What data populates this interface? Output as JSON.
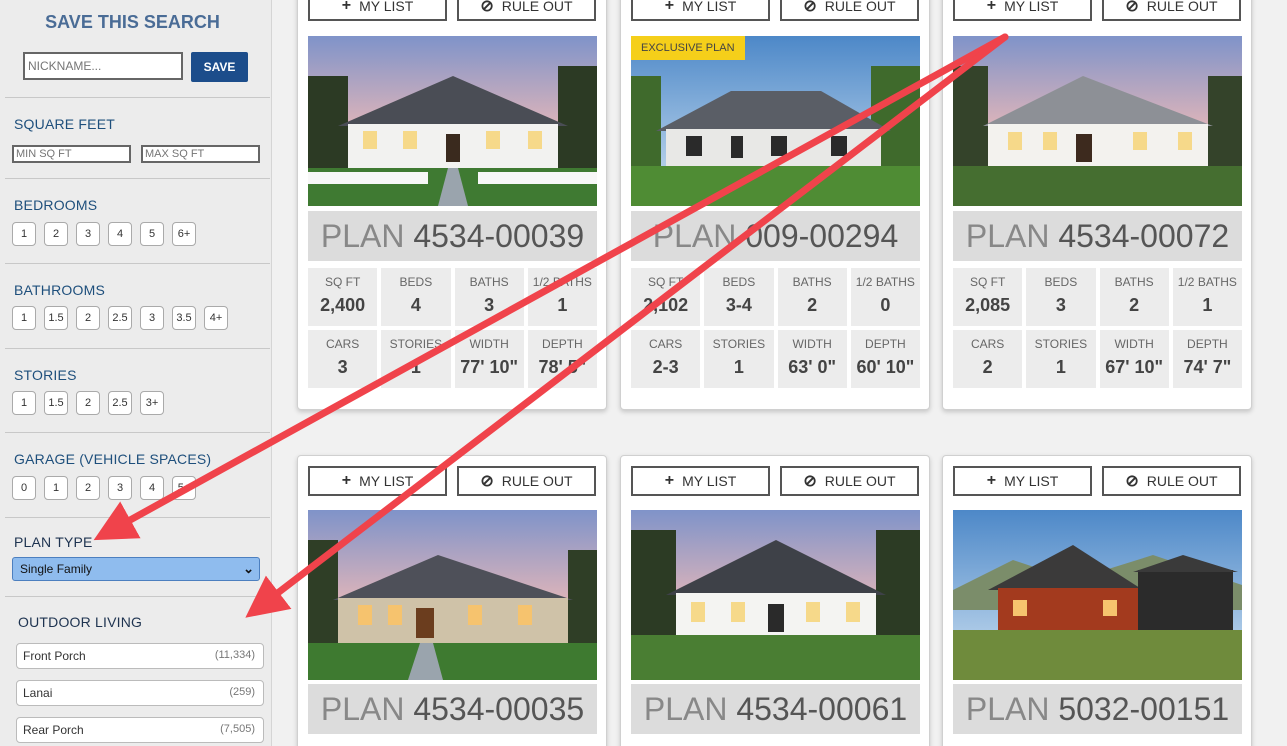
{
  "sidebar": {
    "save_title": "SAVE THIS SEARCH",
    "nickname_placeholder": "NICKNAME...",
    "save_label": "SAVE",
    "square_feet": {
      "title": "SQUARE FEET",
      "min_placeholder": "MIN SQ FT",
      "max_placeholder": "MAX SQ FT"
    },
    "bedrooms": {
      "title": "BEDROOMS",
      "options": [
        "1",
        "2",
        "3",
        "4",
        "5",
        "6+"
      ]
    },
    "bathrooms": {
      "title": "BATHROOMS",
      "options": [
        "1",
        "1.5",
        "2",
        "2.5",
        "3",
        "3.5",
        "4+"
      ]
    },
    "stories": {
      "title": "STORIES",
      "options": [
        "1",
        "1.5",
        "2",
        "2.5",
        "3+"
      ]
    },
    "garage": {
      "title": "GARAGE (VEHICLE SPACES)",
      "options": [
        "0",
        "1",
        "2",
        "3",
        "4",
        "5+"
      ]
    },
    "plan_type": {
      "title": "PLAN TYPE",
      "selected": "Single Family"
    },
    "outdoor_living": {
      "title": "OUTDOOR LIVING",
      "items": [
        {
          "label": "Front Porch",
          "count": "(11,334)"
        },
        {
          "label": "Lanai",
          "count": "(259)"
        },
        {
          "label": "Rear Porch",
          "count": "(7,505)"
        }
      ]
    }
  },
  "buttons": {
    "my_list": "MY LIST",
    "rule_out": "RULE OUT"
  },
  "labels": {
    "plan_prefix": "PLAN",
    "sqft": "SQ FT",
    "beds": "BEDS",
    "baths": "BATHS",
    "half_baths": "1/2 BATHS",
    "cars": "CARS",
    "stories": "STORIES",
    "width": "WIDTH",
    "depth": "DEPTH"
  },
  "cards": [
    {
      "plan": "4534-00039",
      "badge": "",
      "sqft": "2,400",
      "beds": "4",
      "baths": "3",
      "half_baths": "1",
      "cars": "3",
      "stories": "1",
      "width": "77' 10\"",
      "depth": "78' 5\""
    },
    {
      "plan": "009-00294",
      "badge": "EXCLUSIVE PLAN",
      "sqft": "2,102",
      "beds": "3-4",
      "baths": "2",
      "half_baths": "0",
      "cars": "2-3",
      "stories": "1",
      "width": "63' 0\"",
      "depth": "60' 10\""
    },
    {
      "plan": "4534-00072",
      "badge": "",
      "sqft": "2,085",
      "beds": "3",
      "baths": "2",
      "half_baths": "1",
      "cars": "2",
      "stories": "1",
      "width": "67' 10\"",
      "depth": "74' 7\""
    },
    {
      "plan": "4534-00035"
    },
    {
      "plan": "4534-00061"
    },
    {
      "plan": "5032-00151"
    }
  ],
  "colors": {
    "accent": "#1c4d8b",
    "heading": "#1e4f7c",
    "arrow": "#f0434b",
    "badge": "#f5cf1a"
  }
}
